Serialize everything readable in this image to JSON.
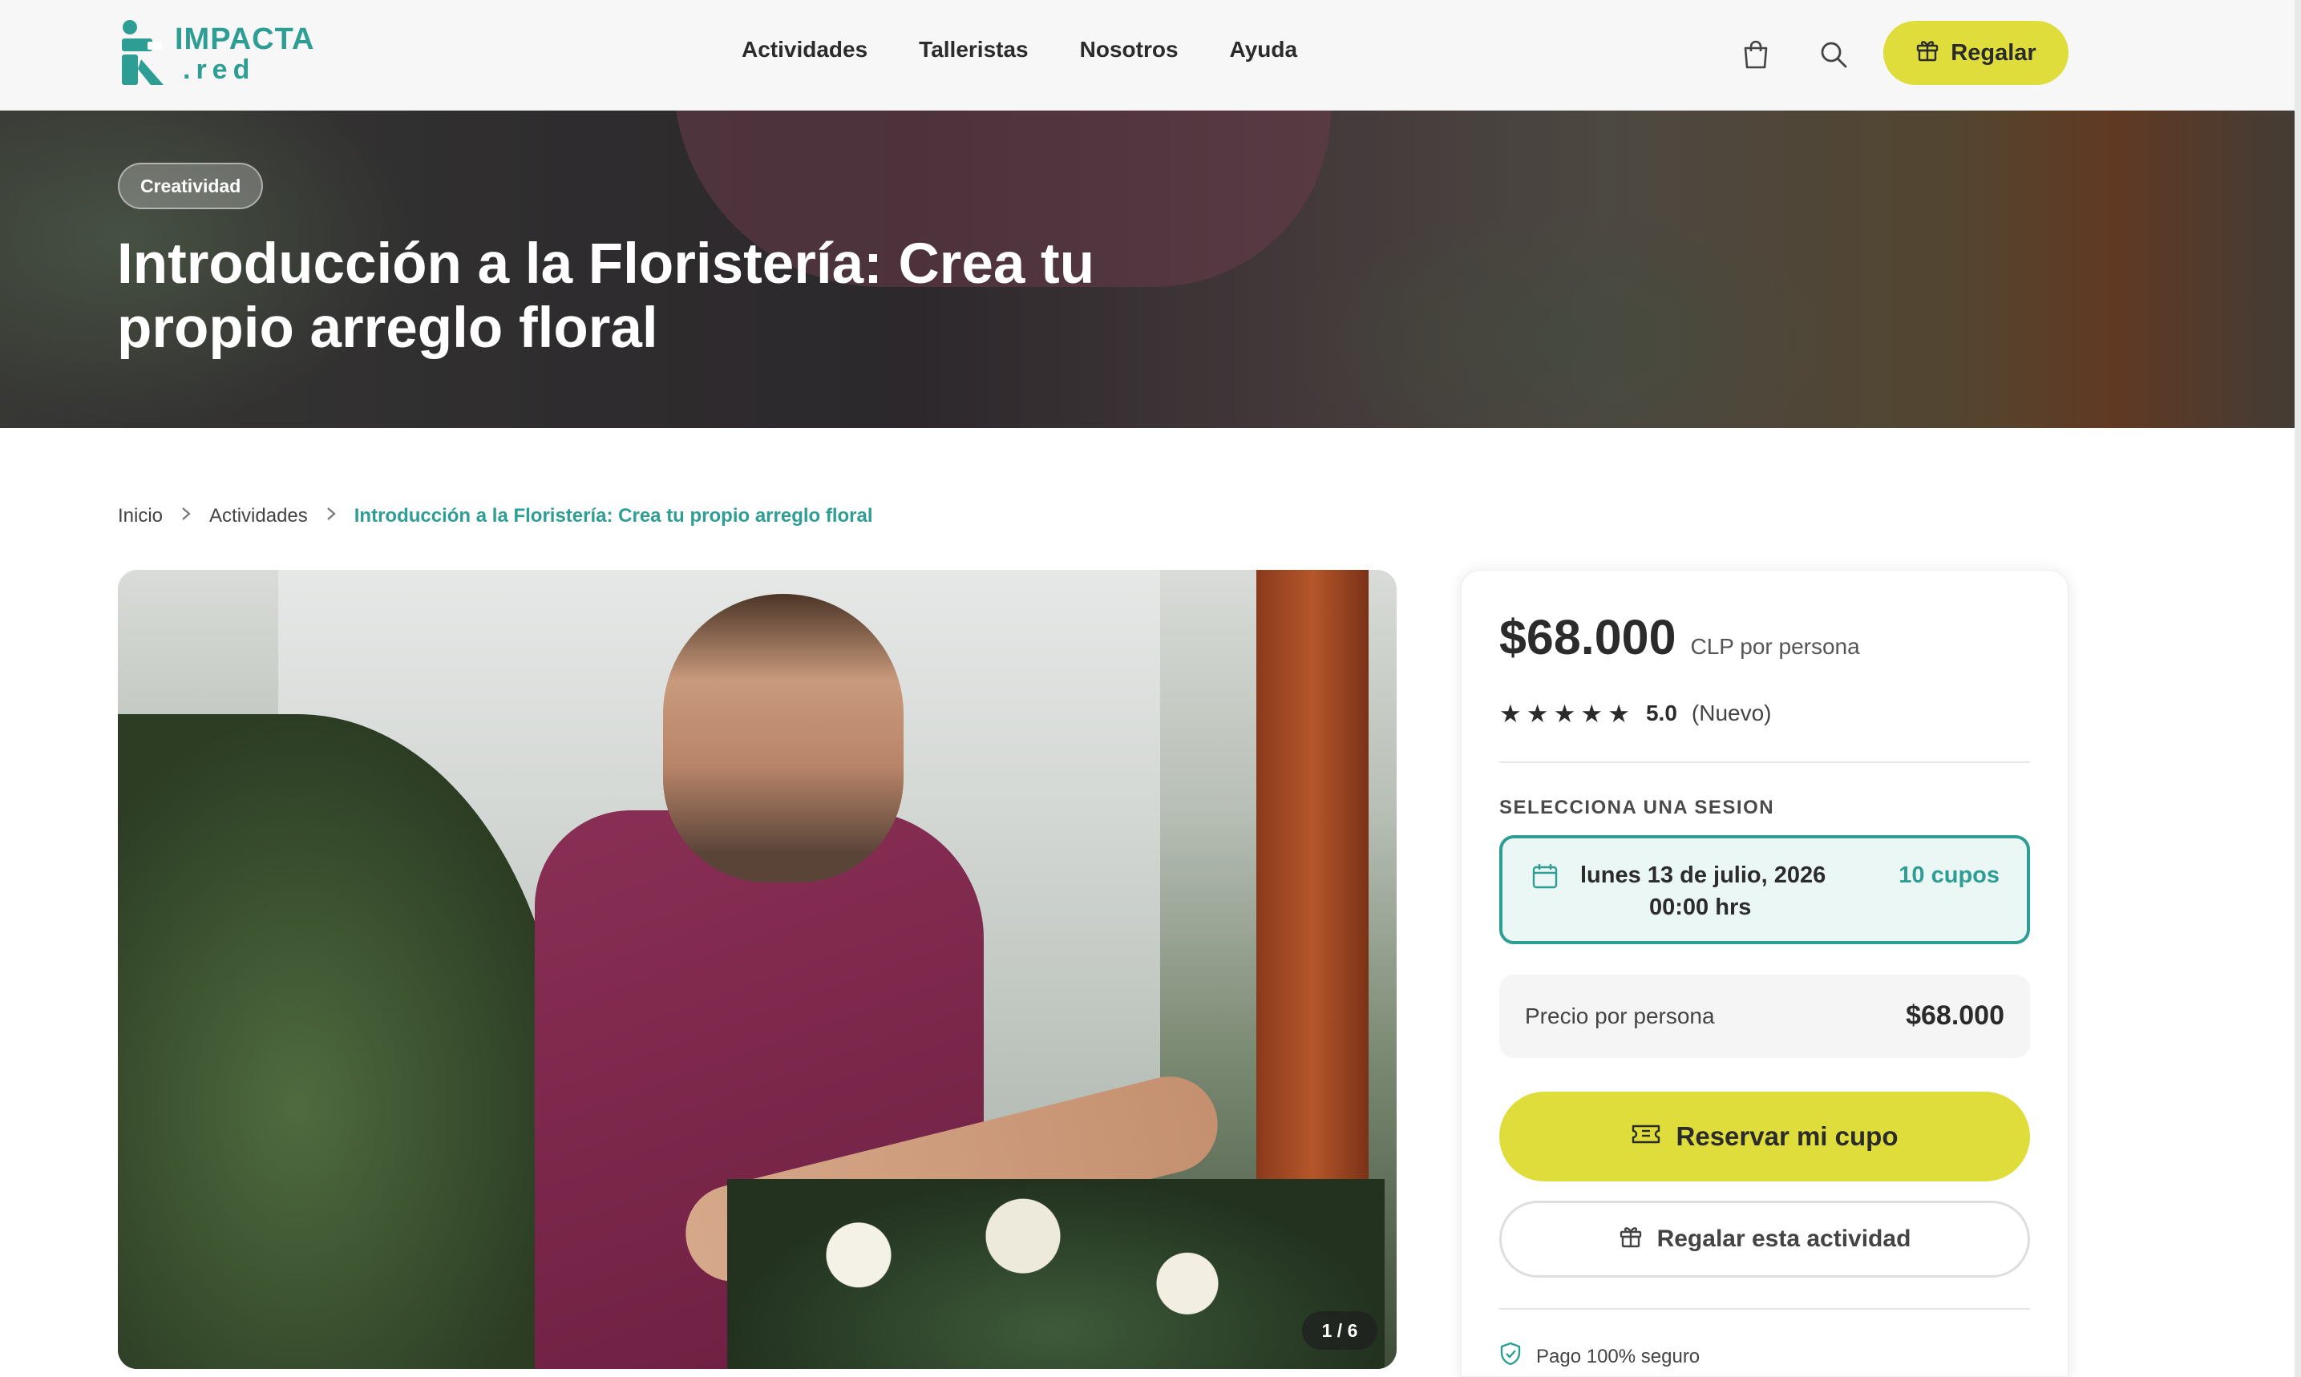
{
  "header": {
    "logo": {
      "line1": "IMPACTA",
      "line2": ".red"
    },
    "nav": [
      "Actividades",
      "Talleristas",
      "Nosotros",
      "Ayuda"
    ],
    "icons": {
      "cart": "shopping-bag-icon",
      "search": "search-icon"
    },
    "regalar_label": "Regalar"
  },
  "hero": {
    "category": "Creatividad",
    "title": "Introducción a la Floristería: Crea tu propio arreglo floral"
  },
  "breadcrumb": {
    "items": [
      "Inicio",
      "Actividades"
    ],
    "current": "Introducción a la Floristería: Crea tu propio arreglo floral"
  },
  "gallery": {
    "counter": "1 / 6"
  },
  "booking": {
    "price": "$68.000",
    "price_unit": "CLP por persona",
    "rating": {
      "stars": 5,
      "value": "5.0",
      "note": "(Nuevo)"
    },
    "select_label": "SELECCIONA UNA SESION",
    "session": {
      "date": "lunes 13 de julio, 2026",
      "time": "00:00 hrs",
      "cupos": "10 cupos"
    },
    "per_person_label": "Precio por persona",
    "per_person_value": "$68.000",
    "reserve_label": "Reservar mi cupo",
    "gift_label": "Regalar esta actividad",
    "secure_label": "Pago 100% seguro"
  },
  "colors": {
    "accent_teal": "#2e9e94",
    "accent_yellow": "#dfdd3c",
    "session_bg": "#eaf7f5"
  }
}
